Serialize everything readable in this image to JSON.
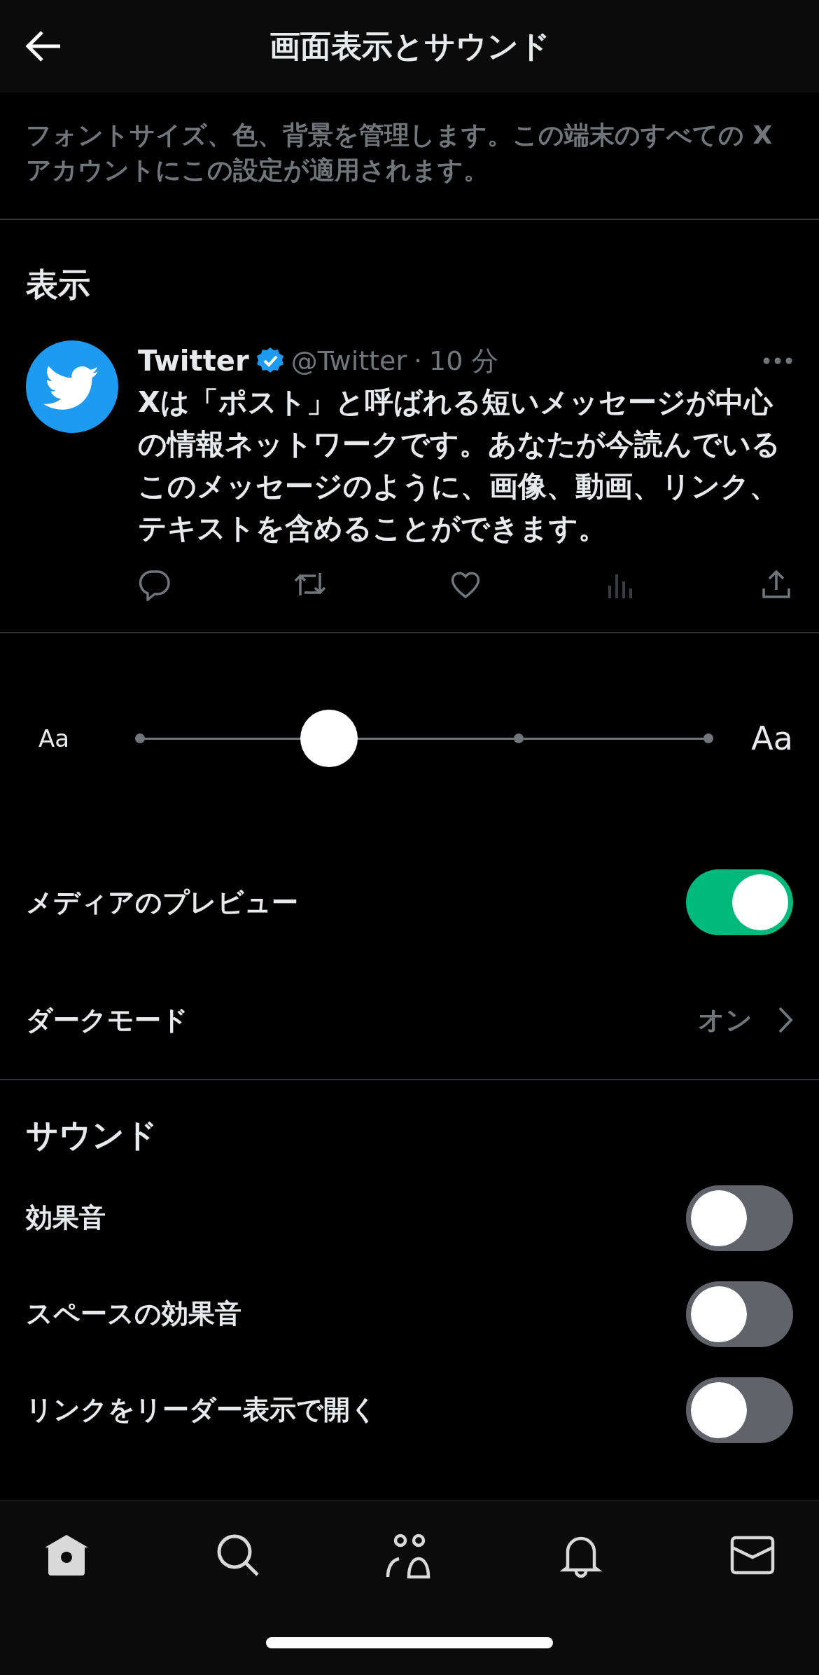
{
  "header": {
    "title": "画面表示とサウンド"
  },
  "description": "フォントサイズ、色、背景を管理します。この端末のすべての X アカウントにこの設定が適用されます。",
  "display": {
    "heading": "表示",
    "post": {
      "name": "Twitter",
      "handle": "@Twitter",
      "separator": "·",
      "time": "10 分",
      "text": "Xは「ポスト」と呼ばれる短いメッセージが中心の情報ネットワークです。あなたが今読んでいるこのメッセージのように、画像、動画、リンク、テキストを含めることができます。"
    },
    "font_size": {
      "small_label": "Aa",
      "large_label": "Aa",
      "level": 0.333
    },
    "settings": [
      {
        "kind": "toggle",
        "label": "メディアのプレビュー",
        "on": true
      },
      {
        "kind": "link",
        "label": "ダークモード",
        "value": "オン"
      }
    ]
  },
  "sound": {
    "heading": "サウンド",
    "settings": [
      {
        "kind": "toggle",
        "label": "効果音",
        "on": false
      },
      {
        "kind": "toggle",
        "label": "スペースの効果音",
        "on": false
      },
      {
        "kind": "toggle",
        "label": "リンクをリーダー表示で開く",
        "on": false
      }
    ]
  }
}
